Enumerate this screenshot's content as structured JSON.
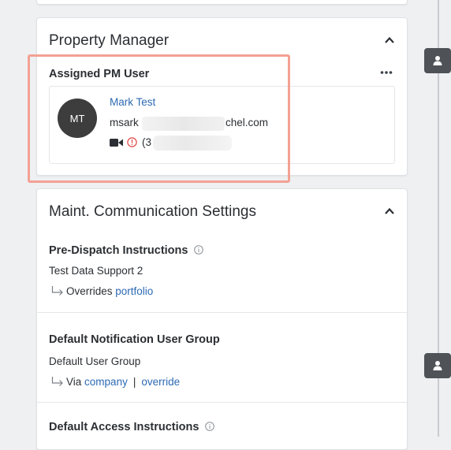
{
  "property_manager": {
    "title": "Property Manager",
    "subtitle": "Assigned PM User",
    "more_label": "•••",
    "user": {
      "initials": "MT",
      "name": "Mark Test",
      "email_start": "msark",
      "email_end": "chel.com",
      "phone_start": "(3"
    }
  },
  "maint": {
    "title": "Maint. Communication Settings",
    "sections": [
      {
        "title": "Pre-Dispatch Instructions",
        "value": "Test Data Support 2",
        "prefix": "Overrides",
        "links": [
          "portfolio"
        ]
      },
      {
        "title": "Default Notification User Group",
        "value": "Default User Group",
        "prefix": "Via",
        "links": [
          "company",
          "override"
        ],
        "separator": "|"
      },
      {
        "title": "Default Access Instructions"
      }
    ]
  },
  "colors": {
    "link": "#2d6ab3",
    "highlight": "#f3a193",
    "avatar": "#3d3d3d",
    "warning": "#e04545"
  }
}
